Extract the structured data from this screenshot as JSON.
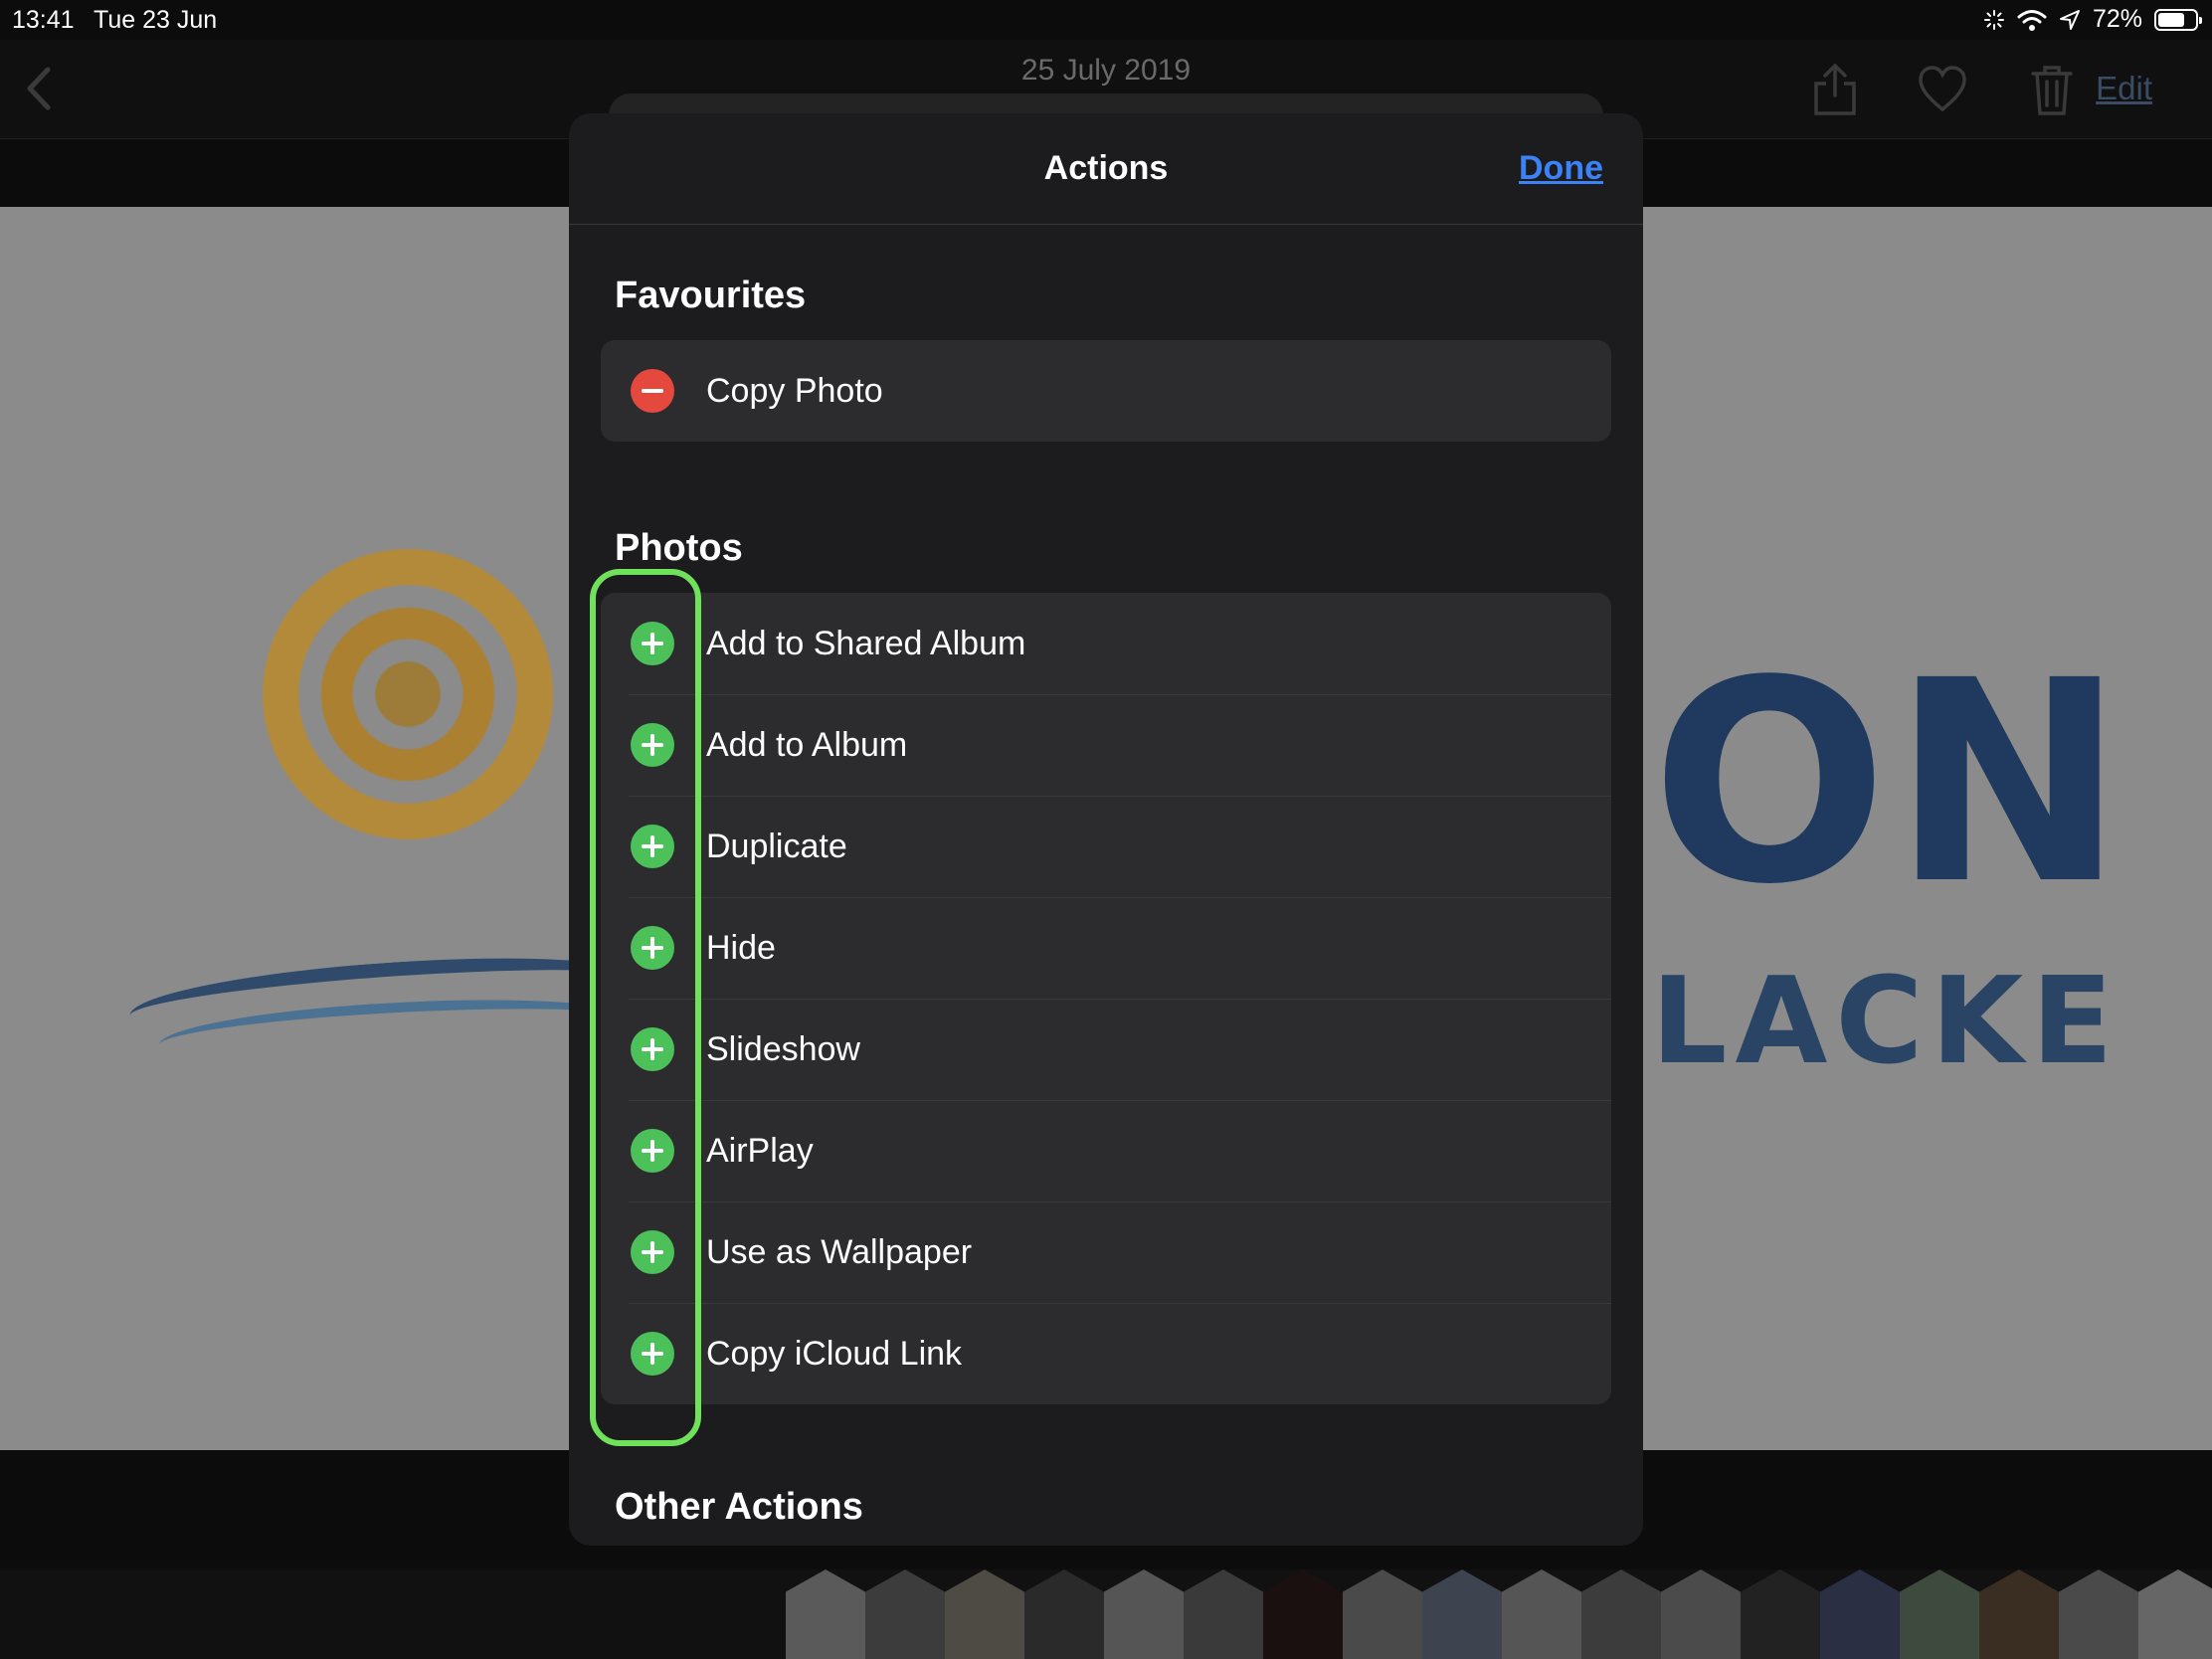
{
  "status_bar": {
    "time": "13:41",
    "date": "Tue 23 Jun",
    "battery": "72%",
    "battery_level": 0.72,
    "icons": [
      "activity-spinner-icon",
      "wifi-icon",
      "location-arrow-icon",
      "battery-icon"
    ]
  },
  "navbar": {
    "title": "25 July 2019",
    "edit_label": "Edit",
    "icons": [
      "back-chevron-icon",
      "share-icon",
      "heart-icon",
      "trash-icon"
    ]
  },
  "photo": {
    "brand_line1": "ON",
    "brand_line2": "LACKE"
  },
  "sheet": {
    "title": "Actions",
    "done_label": "Done",
    "sections": [
      {
        "title": "Favourites",
        "items": [
          {
            "label": "Copy Photo",
            "badge": "remove"
          }
        ]
      },
      {
        "title": "Photos",
        "items": [
          {
            "label": "Add to Shared Album",
            "badge": "add"
          },
          {
            "label": "Add to Album",
            "badge": "add"
          },
          {
            "label": "Duplicate",
            "badge": "add"
          },
          {
            "label": "Hide",
            "badge": "add"
          },
          {
            "label": "Slideshow",
            "badge": "add"
          },
          {
            "label": "AirPlay",
            "badge": "add"
          },
          {
            "label": "Use as Wallpaper",
            "badge": "add"
          },
          {
            "label": "Copy iCloud Link",
            "badge": "add"
          }
        ]
      },
      {
        "title": "Other Actions",
        "items": []
      }
    ]
  },
  "colors": {
    "accent": "#3b82f6",
    "remove": "#e5493e",
    "add": "#4cc15a",
    "highlight": "#6fe15a"
  }
}
